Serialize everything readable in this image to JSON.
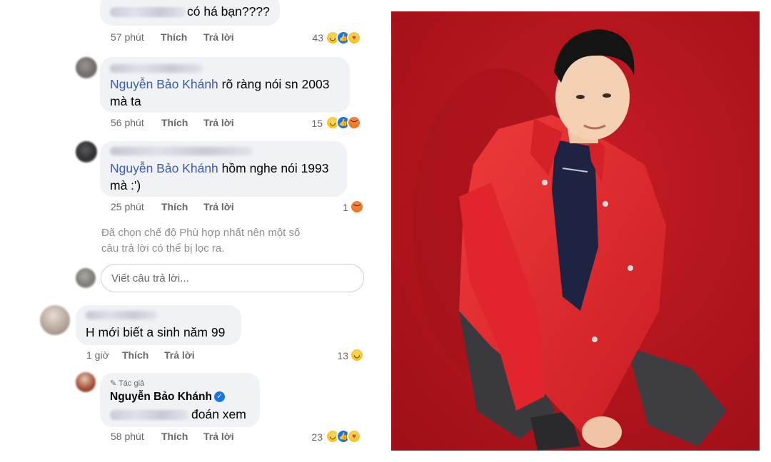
{
  "comments": [
    {
      "text_end": "có há bạn????",
      "time": "57 phút",
      "like_label": "Thích",
      "reply_label": "Trả lời",
      "reaction_count": "43"
    },
    {
      "mention": "Nguyễn Bảo Khánh",
      "text_line1": " rõ ràng nói sn 2003",
      "text_line2": "mà ta",
      "time": "56 phút",
      "like_label": "Thích",
      "reply_label": "Trả lời",
      "reaction_count": "15"
    },
    {
      "mention": "Nguyễn Bảo Khánh",
      "text_line1": " hồm nghe nói 1993",
      "text_line2": "mà :')",
      "time": "25 phút",
      "like_label": "Thích",
      "reply_label": "Trả lời",
      "reaction_count": "1"
    },
    {
      "text": "H mới biết a sinh năm 99",
      "time": "1 giờ",
      "like_label": "Thích",
      "reply_label": "Trả lời",
      "reaction_count": "13"
    },
    {
      "author_badge": "Tác giả",
      "author": "Nguyễn Bảo Khánh",
      "text_end": "đoán xem",
      "time": "58 phút",
      "like_label": "Thích",
      "reply_label": "Trả lời",
      "reaction_count": "23"
    }
  ],
  "filter_notice": {
    "line1": "Đã chọn chế độ Phù hợp nhất nên một số",
    "line2": "câu trả lời có thể bị lọc ra."
  },
  "reply_box": {
    "placeholder": "Viết câu trả lời..."
  },
  "colors": {
    "photo_background": "#b8141e",
    "jacket": "#e52a2f",
    "mention": "#3a5bb0"
  }
}
